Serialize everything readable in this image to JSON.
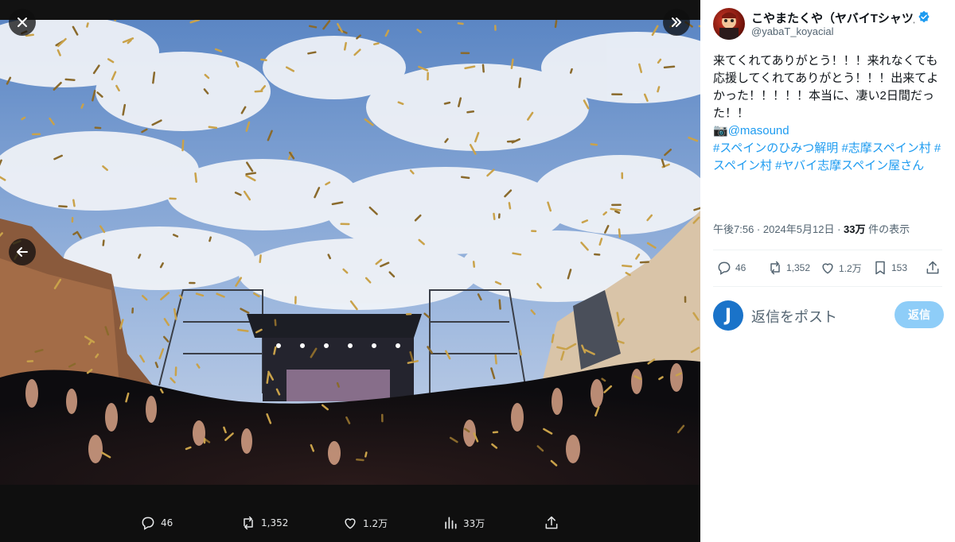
{
  "post": {
    "author_name": "こやまたくや（ヤバイTシャツ屋さん）",
    "author_handle": "@yabaT_koyacial",
    "text_line1": "来てくれてありがとう！！！来れなくても応援してくれてありがとう！！！出来てよかった！！！！！本当に、凄い2日間だった！！",
    "camera_emoji": "📷",
    "mention": "@masound",
    "hashtags": "#スペインのひみつ解明 #志摩スペイン村 #スペイン村 #ヤバイ志摩スペイン屋さん",
    "time": "午後7:56 · 2024年5月12日 · ",
    "views_count": "33万",
    "views_label": " 件の表示"
  },
  "actions": {
    "replies": "46",
    "reposts": "1,352",
    "likes": "1.2万",
    "bookmarks": "153"
  },
  "media_actions": {
    "replies": "46",
    "reposts": "1,352",
    "likes": "1.2万",
    "views": "33万"
  },
  "reply": {
    "avatar_letter": "J",
    "placeholder": "返信をポスト",
    "button": "返信"
  },
  "icons": {
    "close": "close-icon",
    "expand": "double-chevron-icon",
    "prev": "arrow-left-icon",
    "verified": "verified-badge-icon"
  },
  "colors": {
    "accent": "#1d9bf0",
    "reply_button": "#8ecdf8"
  }
}
